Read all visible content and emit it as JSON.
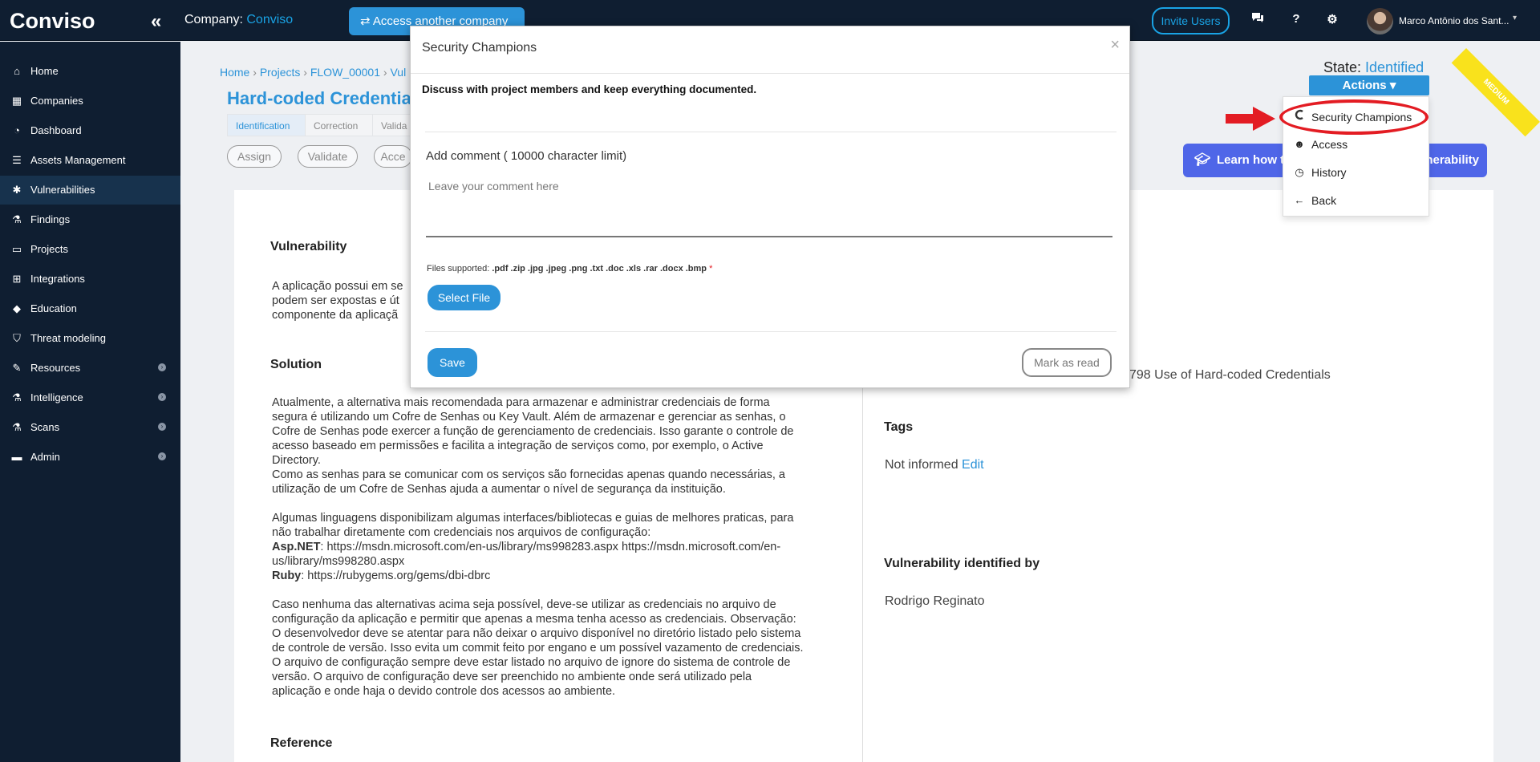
{
  "topbar": {
    "logo_text": "Conviso",
    "collapse_icon": "double-chevron-left-icon",
    "company_label": "Company: ",
    "company_name": "Conviso",
    "access_another_label": "Access another company",
    "invite_users_label": "Invite Users",
    "chat_icon": "chat-icon",
    "help_label": "?",
    "settings_icon": "gear-icon",
    "user_name": "Marco Antônio dos Sant..."
  },
  "sidebar": {
    "items": [
      {
        "label": "Home",
        "icon": "home-icon"
      },
      {
        "label": "Companies",
        "icon": "building-icon"
      },
      {
        "label": "Dashboard",
        "icon": "gauge-icon"
      },
      {
        "label": "Assets Management",
        "icon": "server-icon"
      },
      {
        "label": "Vulnerabilities",
        "icon": "bug-icon",
        "active": true
      },
      {
        "label": "Findings",
        "icon": "flask-icon"
      },
      {
        "label": "Projects",
        "icon": "folder-icon"
      },
      {
        "label": "Integrations",
        "icon": "network-icon"
      },
      {
        "label": "Education",
        "icon": "graduation-cap-icon"
      },
      {
        "label": "Threat modeling",
        "icon": "shield-icon"
      },
      {
        "label": "Resources",
        "icon": "wrench-icon",
        "has_submenu": true
      },
      {
        "label": "Intelligence",
        "icon": "flask-icon",
        "has_submenu": true
      },
      {
        "label": "Scans",
        "icon": "flask-icon",
        "has_submenu": true
      },
      {
        "label": "Admin",
        "icon": "briefcase-icon",
        "has_submenu": true
      }
    ]
  },
  "breadcrumb": {
    "home": "Home",
    "sep": " › ",
    "projects": "Projects",
    "project": "FLOW_00001",
    "partial": "Vul"
  },
  "page": {
    "title": "Hard-coded Credential",
    "steps": [
      "Identification",
      "Correction",
      "Valida"
    ],
    "pills": [
      "Assign",
      "Validate",
      "Acce"
    ],
    "state_label": "State: ",
    "state_value": "Identified",
    "actions_label": "Actions ▾",
    "severity_ribbon": "MEDIUM",
    "learn_label": "Learn how t",
    "learn_end": "nerability"
  },
  "left_column": {
    "vulnerability_title": "Vulnerability",
    "vulnerability_text": [
      "A aplicação possui em se",
      "podem ser expostas e út",
      "componente da aplicaçã"
    ],
    "solution_title": "Solution",
    "solution_lines": [
      "Atualmente, a alternativa mais recomendada para armazenar e administrar credenciais de forma",
      "segura é utilizando um Cofre de Senhas ou Key Vault. Além de armazenar e gerenciar as senhas, o",
      "Cofre de Senhas pode exercer a função de gerenciamento de credenciais. Isso garante o controle de",
      "acesso baseado em permissões e facilita a integração de serviços como, por exemplo, o Active",
      "Directory.",
      "Como as senhas para se comunicar com os serviços são fornecidas apenas quando necessárias, a",
      "utilização de um Cofre de Senhas ajuda a aumentar o nível de segurança da instituição.",
      "",
      "Algumas linguagens disponibilizam algumas interfaces/bibliotecas e guias de melhores praticas, para",
      "não trabalhar diretamente com credenciais nos arquivos de configuração:"
    ],
    "aspnet_label": "Asp.NET",
    "aspnet_text_1": ": https://msdn.microsoft.com/en-us/library/ms998283.aspx https://msdn.microsoft.com/en-",
    "aspnet_text_2": "us/library/ms998280.aspx",
    "ruby_label": "Ruby",
    "ruby_text": ": https://rubygems.org/gems/dbi-dbrc",
    "solution_lines_2": [
      "Caso nenhuma das alternativas acima seja possível, deve-se utilizar as credenciais no arquivo de",
      "configuração da aplicação e permitir que apenas a mesma tenha acesso as credenciais. Observação:",
      "O desenvolvedor deve se atentar para não deixar o arquivo disponível no diretório listado pelo sistema",
      "de controle de versão. Isso evita um commit feito por engano e um possível vazamento de credenciais.",
      "O arquivo de configuração sempre deve estar listado no arquivo de ignore do sistema de controle de",
      "versão. O arquivo de configuração deve ser preenchido no ambiente onde será utilizado pela",
      "aplicação e onde haja o devido controle dos acessos ao ambiente."
    ],
    "reference_title": "Reference"
  },
  "right_column": {
    "cwe_text": "798 Use of Hard-coded Credentials",
    "tags_title": "Tags",
    "tags_value": "Not informed ",
    "tags_edit": "Edit",
    "identified_by_title": "Vulnerability identified by",
    "identified_by_value": "Rodrigo Reginato"
  },
  "actions_menu": {
    "items": [
      {
        "label": "Security Champions",
        "icon": "conviso-c-icon"
      },
      {
        "label": "Access",
        "icon": "users-icon"
      },
      {
        "label": "History",
        "icon": "clock-icon"
      },
      {
        "label": "Back",
        "icon": "arrow-left-icon"
      }
    ]
  },
  "modal": {
    "title": "Security Champions",
    "close": "×",
    "description": "Discuss with project members and keep everything documented.",
    "comment_label": "Add comment ( 10000 character limit)",
    "comment_placeholder": "Leave your comment here",
    "files_label": "Files supported: ",
    "files_types": ".pdf .zip .jpg .jpeg .png .txt .doc .xls .rar .docx .bmp",
    "files_required": " *",
    "select_file_label": "Select File",
    "save_label": "Save",
    "mark_read_label": "Mark as read"
  },
  "colors": {
    "sidebar_bg": "#0f1e31",
    "accent": "#2c93d8",
    "highlight": "#e31c23",
    "ribbon": "#f9e21c",
    "learn_button": "#4f66e8"
  }
}
